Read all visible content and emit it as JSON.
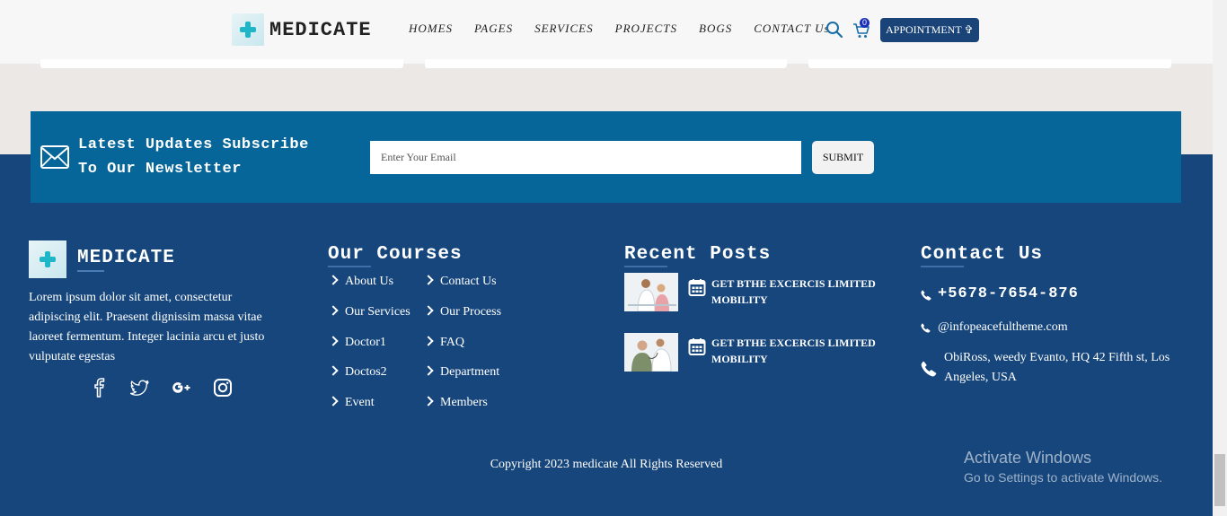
{
  "header": {
    "brand": "MEDICATE",
    "nav": [
      "HOMES",
      "PAGES",
      "SERVICES",
      "PROJECTS",
      "BOGS",
      "CONTACT Us"
    ],
    "cart_count": "0",
    "appointment_label": "APPOINTMENT ✞"
  },
  "newsletter": {
    "title_line1": "Latest Updates Subscribe",
    "title_line2": "To Our Newsletter",
    "placeholder": "Enter Your Email",
    "submit_label": "SUBMIT"
  },
  "footer": {
    "brand": "MEDICATE",
    "about_text": "Lorem ipsum dolor sit amet, consectetur adipiscing elit. Praesent dignissim massa vitae laoreet fermentum. Integer lacinia arcu et justo vulputate egestas",
    "social_icons": [
      "facebook-icon",
      "twitter-icon",
      "google-plus-icon",
      "instagram-icon"
    ],
    "courses": {
      "heading": "Our Courses",
      "col1": [
        "About Us",
        "Our Services",
        "Doctor1",
        "Doctos2",
        "Event"
      ],
      "col2": [
        "Contact Us",
        "Our Process",
        "FAQ",
        "Department",
        "Members"
      ]
    },
    "recent_posts": {
      "heading": "Recent Posts",
      "items": [
        {
          "title": "GET BTHE EXCERCIS LIMITED MOBILITY"
        },
        {
          "title": "GET BTHE EXCERCIS LIMITED MOBILITY"
        }
      ]
    },
    "contact": {
      "heading": "Contact Us",
      "phone": "+5678-7654-876",
      "email": "@infopeacefultheme.com",
      "address": "ObiRoss, weedy Evanto, HQ 42 Fifth st, Los Angeles, USA"
    },
    "copyright": "Copyright 2023 medicate All Rights Reserved"
  },
  "watermark": {
    "line1": "Activate Windows",
    "line2": "Go to Settings to activate Windows."
  },
  "colors": {
    "footer_bg": "#16467c",
    "newsletter_bg": "#066599",
    "accent_teal": "#1fb7c7",
    "appointment_bg": "#1a4377"
  }
}
